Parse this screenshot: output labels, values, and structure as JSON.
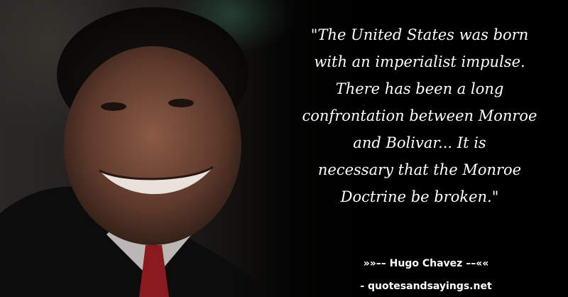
{
  "quote": {
    "lines": [
      "\"The United States was born",
      "with an imperialist impulse.",
      "There has been a long",
      "confrontation between Monroe",
      "and Bolivar... It is",
      "necessary that the Monroe",
      "Doctrine be broken.\""
    ]
  },
  "author_line": "»»–– Hugo Chavez ––««",
  "site_line": "- quotesandsayings.net",
  "colors": {
    "background": "#000000",
    "text": "#ffffff"
  }
}
